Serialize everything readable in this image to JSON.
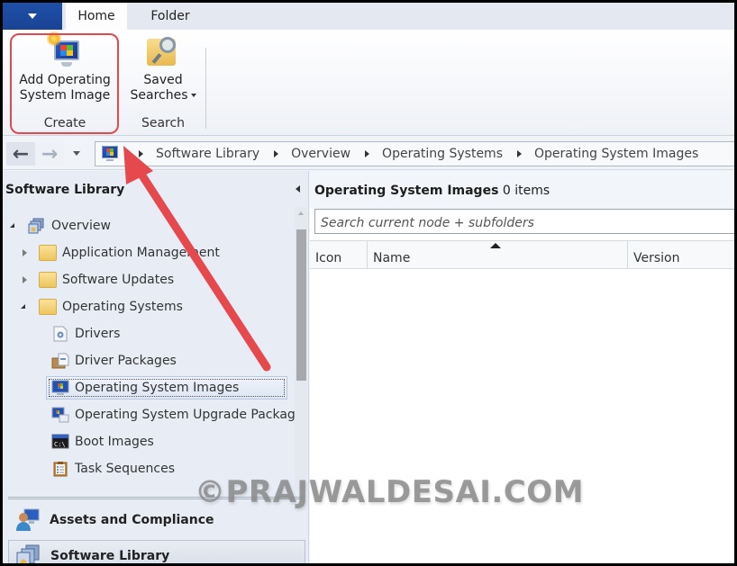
{
  "ribbon": {
    "tabs": [
      {
        "label": "Home",
        "active": true
      },
      {
        "label": "Folder",
        "active": false
      }
    ],
    "groups": [
      {
        "label": "Create",
        "buttons": [
          {
            "label_line1": "Add Operating",
            "label_line2": "System Image",
            "icon": "add-os-image-icon",
            "highlighted": true
          }
        ]
      },
      {
        "label": "Search",
        "buttons": [
          {
            "label_line1": "Saved",
            "label_line2": "Searches",
            "icon": "saved-searches-icon",
            "has_dropdown": true
          }
        ]
      }
    ]
  },
  "navigation": {
    "back_icon": "←",
    "forward_icon": "→",
    "breadcrumb": [
      "Software Library",
      "Overview",
      "Operating Systems",
      "Operating System Images"
    ]
  },
  "left_pane": {
    "title": "Software Library",
    "tree": [
      {
        "label": "Overview",
        "level": 0,
        "expanded": true,
        "icon": "overview-icon"
      },
      {
        "label": "Application Management",
        "level": 1,
        "expanded": false,
        "icon": "folder-icon"
      },
      {
        "label": "Software Updates",
        "level": 1,
        "expanded": false,
        "icon": "folder-icon"
      },
      {
        "label": "Operating Systems",
        "level": 1,
        "expanded": true,
        "icon": "folder-icon"
      },
      {
        "label": "Drivers",
        "level": 2,
        "icon": "drivers-icon"
      },
      {
        "label": "Driver Packages",
        "level": 2,
        "icon": "driver-packages-icon"
      },
      {
        "label": "Operating System Images",
        "level": 2,
        "icon": "os-image-icon",
        "selected": true
      },
      {
        "label": "Operating System Upgrade Package",
        "level": 2,
        "icon": "os-upgrade-package-icon"
      },
      {
        "label": "Boot Images",
        "level": 2,
        "icon": "boot-images-icon"
      },
      {
        "label": "Task Sequences",
        "level": 2,
        "icon": "task-sequences-icon"
      }
    ],
    "workspaces": [
      {
        "label": "Assets and Compliance",
        "active": false
      },
      {
        "label": "Software Library",
        "active": true
      }
    ]
  },
  "right_pane": {
    "title": "Operating System Images",
    "count_text": "0 items",
    "search_placeholder": "Search current node + subfolders",
    "columns": [
      "Icon",
      "Name",
      "Version"
    ],
    "sorted_column": "Name",
    "rows": []
  },
  "annotation": {
    "color": "#e5484d"
  },
  "watermark": "©PRAJWALDESAI.COM"
}
